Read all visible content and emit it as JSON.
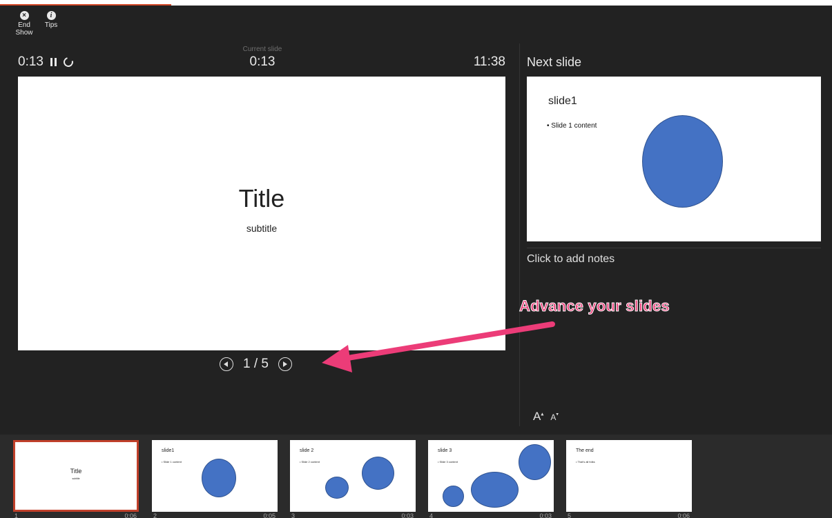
{
  "toolbar": {
    "end_show_label": "End Show",
    "tips_label": "Tips"
  },
  "timers": {
    "elapsed": "0:13",
    "current_slide_label": "Current slide",
    "current_slide_time": "0:13",
    "clock": "11:38"
  },
  "main_slide": {
    "title": "Title",
    "subtitle": "subtitle"
  },
  "navigation": {
    "position": "1 / 5"
  },
  "next_slide": {
    "label": "Next slide",
    "title": "slide1",
    "bullet": "• Slide 1 content"
  },
  "notes": {
    "placeholder": "Click to add notes"
  },
  "font_controls": {
    "increase": "A",
    "decrease": "A"
  },
  "annotation": {
    "text": "Advance your slides",
    "color": "#ec3c78"
  },
  "thumbnails": [
    {
      "number": "1",
      "time": "0:06",
      "title": "Title",
      "subtitle": "subtitle"
    },
    {
      "number": "2",
      "time": "0:05",
      "title": "slide1",
      "bullet": "• Slide 1 content"
    },
    {
      "number": "3",
      "time": "0:03",
      "title": "slide 2",
      "bullet": "• Slide 2 content"
    },
    {
      "number": "4",
      "time": "0:03",
      "title": "slide 3",
      "bullet": "• Slide 3 content"
    },
    {
      "number": "5",
      "time": "0:06",
      "title": "The end",
      "bullet": "• That's all folks"
    }
  ],
  "colors": {
    "background": "#222222",
    "accent": "#d24726",
    "shape_fill": "#4472c4"
  }
}
